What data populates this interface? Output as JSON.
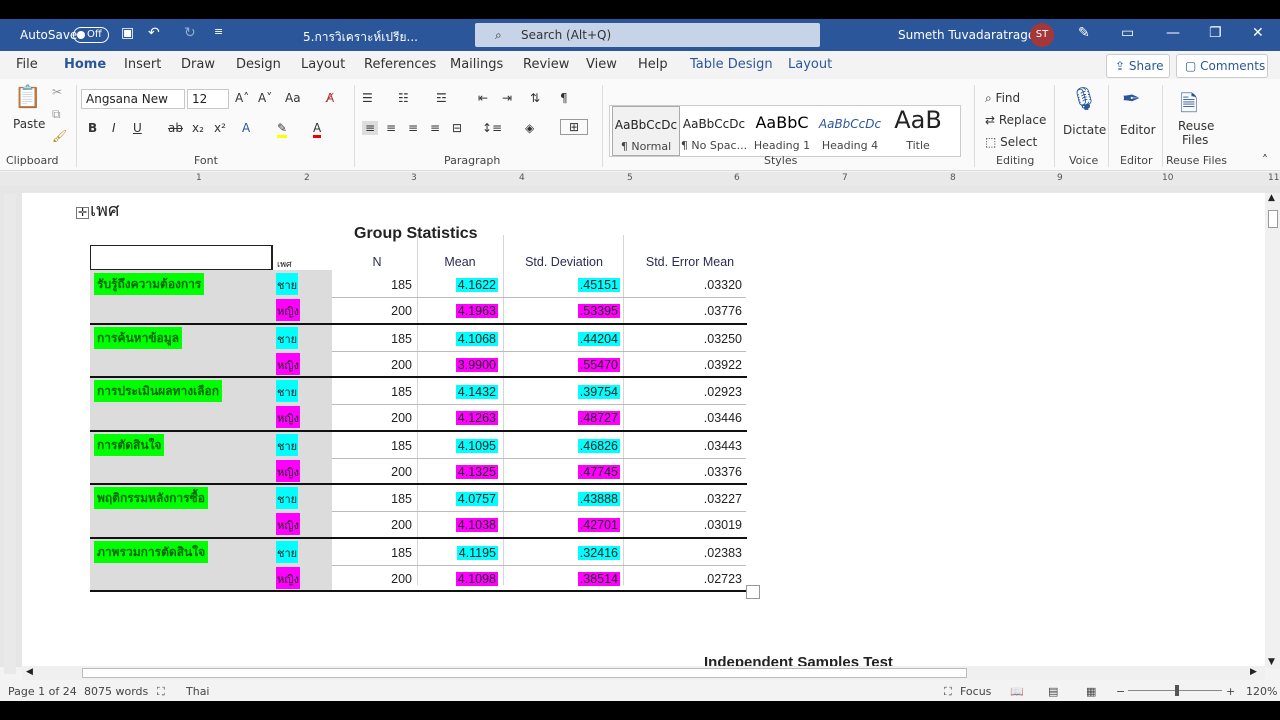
{
  "titlebar": {
    "autosave": "AutoSave",
    "toggle": "Off",
    "filename": "5.การวิเคราะห์เปรีย...",
    "search": "Search (Alt+Q)",
    "user": "Sumeth Tuvadaratragool",
    "initials": "ST"
  },
  "tabs": [
    "File",
    "Home",
    "Insert",
    "Draw",
    "Design",
    "Layout",
    "References",
    "Mailings",
    "Review",
    "View",
    "Help",
    "Table Design",
    "Layout"
  ],
  "share": "Share",
  "comments": "Comments",
  "ribbon": {
    "clipboard": {
      "paste": "Paste",
      "label": "Clipboard"
    },
    "font": {
      "name": "Angsana New",
      "size": "12",
      "label": "Font"
    },
    "paragraph": {
      "label": "Paragraph"
    },
    "styles": {
      "label": "Styles",
      "items": [
        {
          "preview": "AaBbCcDc",
          "name": "¶ Normal"
        },
        {
          "preview": "AaBbCcDc",
          "name": "¶ No Spac..."
        },
        {
          "preview": "AaBbC",
          "name": "Heading 1"
        },
        {
          "preview": "AaBbCcDc",
          "name": "Heading 4"
        },
        {
          "preview": "AaB",
          "name": "Title"
        }
      ]
    },
    "editing": {
      "find": "Find",
      "replace": "Replace",
      "select": "Select",
      "label": "Editing"
    },
    "voice": {
      "dictate": "Dictate",
      "label": "Voice"
    },
    "editor": {
      "editor": "Editor",
      "label": "Editor"
    },
    "reuse": {
      "line1": "Reuse",
      "line2": "Files",
      "label": "Reuse Files"
    }
  },
  "ruler": [
    "1",
    "2",
    "3",
    "4",
    "5",
    "6",
    "7",
    "8",
    "9",
    "10",
    "11"
  ],
  "doc": {
    "heading": "เพศ",
    "title": "Group Statistics",
    "headers": {
      "sex": "เพศ",
      "n": "N",
      "mean": "Mean",
      "sd": "Std. Deviation",
      "se": "Std. Error Mean"
    },
    "groups": [
      {
        "label": "รับรู้ถึงความต้องการ",
        "rows": [
          {
            "sex": "ชาย",
            "n": "185",
            "mean": "4.1622",
            "sd": ".45151",
            "se": ".03320"
          },
          {
            "sex": "หญิง",
            "n": "200",
            "mean": "4.1963",
            "sd": ".53395",
            "se": ".03776"
          }
        ]
      },
      {
        "label": "การค้นหาข้อมูล",
        "rows": [
          {
            "sex": "ชาย",
            "n": "185",
            "mean": "4.1068",
            "sd": ".44204",
            "se": ".03250"
          },
          {
            "sex": "หญิง",
            "n": "200",
            "mean": "3.9900",
            "sd": ".55470",
            "se": ".03922"
          }
        ]
      },
      {
        "label": "การประเมินผลทางเลือก",
        "rows": [
          {
            "sex": "ชาย",
            "n": "185",
            "mean": "4.1432",
            "sd": ".39754",
            "se": ".02923"
          },
          {
            "sex": "หญิง",
            "n": "200",
            "mean": "4.1263",
            "sd": ".48727",
            "se": ".03446"
          }
        ]
      },
      {
        "label": "การตัดสินใจ",
        "rows": [
          {
            "sex": "ชาย",
            "n": "185",
            "mean": "4.1095",
            "sd": ".46826",
            "se": ".03443"
          },
          {
            "sex": "หญิง",
            "n": "200",
            "mean": "4.1325",
            "sd": ".47745",
            "se": ".03376"
          }
        ]
      },
      {
        "label": "พฤติกรรมหลังการซื้อ",
        "rows": [
          {
            "sex": "ชาย",
            "n": "185",
            "mean": "4.0757",
            "sd": ".43888",
            "se": ".03227"
          },
          {
            "sex": "หญิง",
            "n": "200",
            "mean": "4.1038",
            "sd": ".42701",
            "se": ".03019"
          }
        ]
      },
      {
        "label": "ภาพรวมการตัดสินใจ",
        "rows": [
          {
            "sex": "ชาย",
            "n": "185",
            "mean": "4.1195",
            "sd": ".32416",
            "se": ".02383"
          },
          {
            "sex": "หญิง",
            "n": "200",
            "mean": "4.1098",
            "sd": ".38514",
            "se": ".02723"
          }
        ]
      }
    ],
    "next_title": "Independent Samples Test"
  },
  "status": {
    "page": "Page 1 of 24",
    "words": "8075 words",
    "lang": "Thai",
    "focus": "Focus",
    "zoom": "120%"
  },
  "colors": {
    "brand": "#2b579a",
    "male": "#00ffff",
    "female": "#ff00ff",
    "label": "#00ff00"
  }
}
